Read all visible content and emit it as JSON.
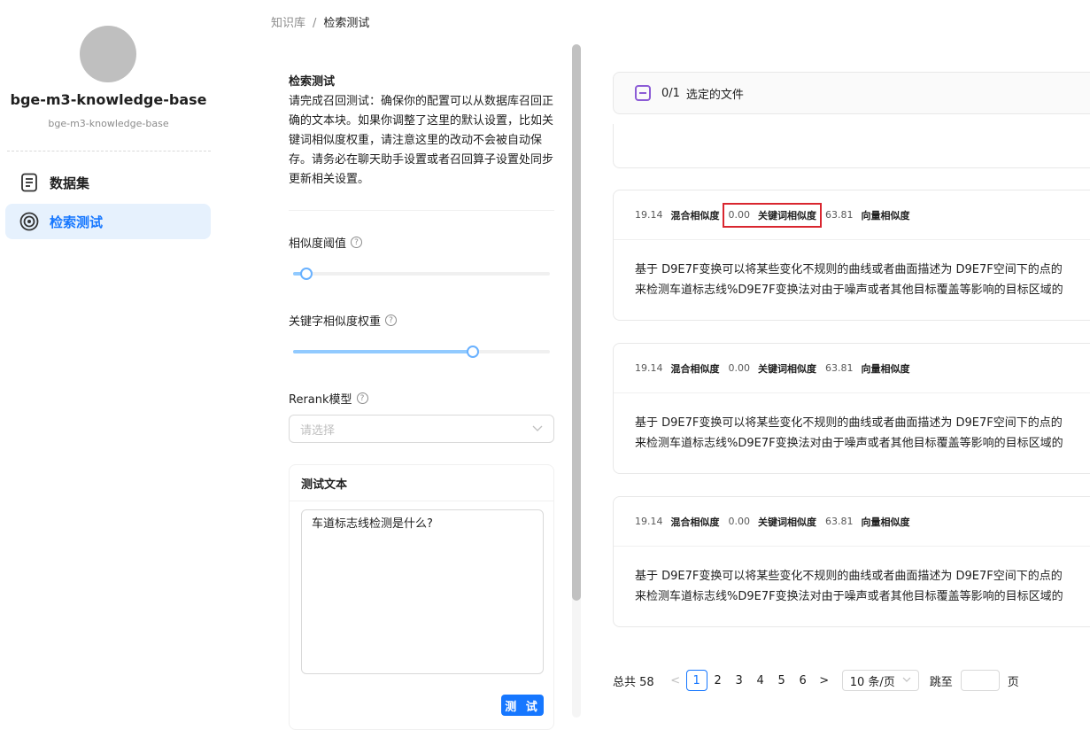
{
  "sidebar": {
    "kb_name": "bge-m3-knowledge-base",
    "kb_subtitle": "bge-m3-knowledge-base",
    "items": [
      {
        "label": "数据集",
        "icon": "document-icon",
        "active": false
      },
      {
        "label": "检索测试",
        "icon": "target-icon",
        "active": true
      }
    ]
  },
  "breadcrumb": {
    "root": "知识库",
    "separator": "/",
    "current": "检索测试"
  },
  "config": {
    "title": "检索测试",
    "description": "请完成召回测试：确保你的配置可以从数据库召回正确的文本块。如果你调整了这里的默认设置，比如关键词相似度权重，请注意这里的改动不会被自动保存。请务必在聊天助手设置或者召回算子设置处同步更新相关设置。",
    "similarity_threshold_label": "相似度阈值",
    "similarity_threshold_value": 0.05,
    "keyword_weight_label": "关键字相似度权重",
    "keyword_weight_value": 0.7,
    "rerank_label": "Rerank模型",
    "rerank_placeholder": "请选择",
    "help_icon": "?"
  },
  "test_panel": {
    "title": "测试文本",
    "text": "车道标志线检测是什么?",
    "button": "测 试"
  },
  "file_selector": {
    "count": "0/1",
    "label": "选定的文件"
  },
  "results": [
    {
      "hybrid_score": "19.14",
      "hybrid_label": "混合相似度",
      "keyword_score": "0.00",
      "keyword_label": "关键词相似度",
      "vector_score": "63.81",
      "vector_label": "向量相似度",
      "line1": "基于 D9E7F变换可以将某些变化不规则的曲线或者曲面描述为 D9E7F空间下的点的",
      "line2": "来检测车道标志线%D9E7F变换法对由于噪声或者其他目标覆盖等影响的目标区域的",
      "highlighted": true
    },
    {
      "hybrid_score": "19.14",
      "hybrid_label": "混合相似度",
      "keyword_score": "0.00",
      "keyword_label": "关键词相似度",
      "vector_score": "63.81",
      "vector_label": "向量相似度",
      "line1": "基于 D9E7F变换可以将某些变化不规则的曲线或者曲面描述为 D9E7F空间下的点的",
      "line2": "来检测车道标志线%D9E7F变换法对由于噪声或者其他目标覆盖等影响的目标区域的",
      "highlighted": false
    },
    {
      "hybrid_score": "19.14",
      "hybrid_label": "混合相似度",
      "keyword_score": "0.00",
      "keyword_label": "关键词相似度",
      "vector_score": "63.81",
      "vector_label": "向量相似度",
      "line1": "基于 D9E7F变换可以将某些变化不规则的曲线或者曲面描述为 D9E7F空间下的点的",
      "line2": "来检测车道标志线%D9E7F变换法对由于噪声或者其他目标覆盖等影响的目标区域的",
      "highlighted": false
    }
  ],
  "pagination": {
    "total": "总共 58",
    "pages": [
      "1",
      "2",
      "3",
      "4",
      "5",
      "6"
    ],
    "current": "1",
    "prev": "<",
    "next": ">",
    "page_size": "10 条/页",
    "jump_label": "跳至",
    "jump_suffix": "页"
  },
  "colors": {
    "accent": "#1677ff",
    "highlight_box": "#d9262f",
    "checkbox": "#8c5cd6"
  }
}
